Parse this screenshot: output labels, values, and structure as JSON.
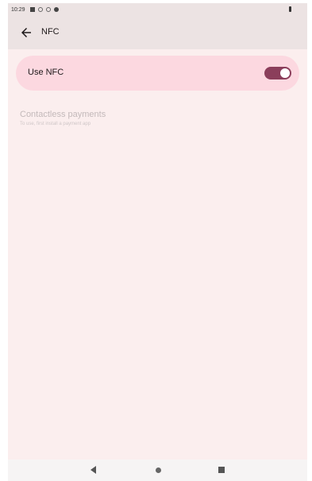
{
  "status_bar": {
    "time": "10:29"
  },
  "app_bar": {
    "title": "NFC"
  },
  "nfc_toggle": {
    "label": "Use NFC",
    "enabled": true
  },
  "contactless": {
    "title": "Contactless payments",
    "subtitle": "To use, first install a payment app"
  },
  "colors": {
    "accent": "#8b3e5b",
    "card": "#fcd8e0",
    "background": "#fbeeee"
  }
}
